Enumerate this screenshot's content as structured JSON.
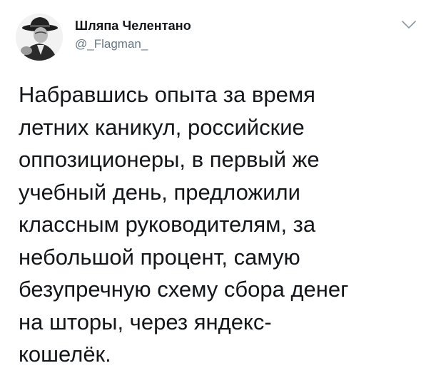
{
  "author": {
    "display_name": "Шляпа Челентано",
    "handle": "@_Flagman_",
    "avatar_icon": "person-in-hat-avatar"
  },
  "menu": {
    "icon": "chevron-down-icon"
  },
  "tweet": {
    "lines": [
      "Набравшись опыта за время",
      "летних каникул, российские",
      "оппозиционеры, в первый же",
      "учебный день, предложили",
      "классным руководителям, за",
      "небольшой процент, самую",
      "безупречную схему сбора денег",
      "на шторы, через яндекс-",
      "кошелёк."
    ]
  }
}
